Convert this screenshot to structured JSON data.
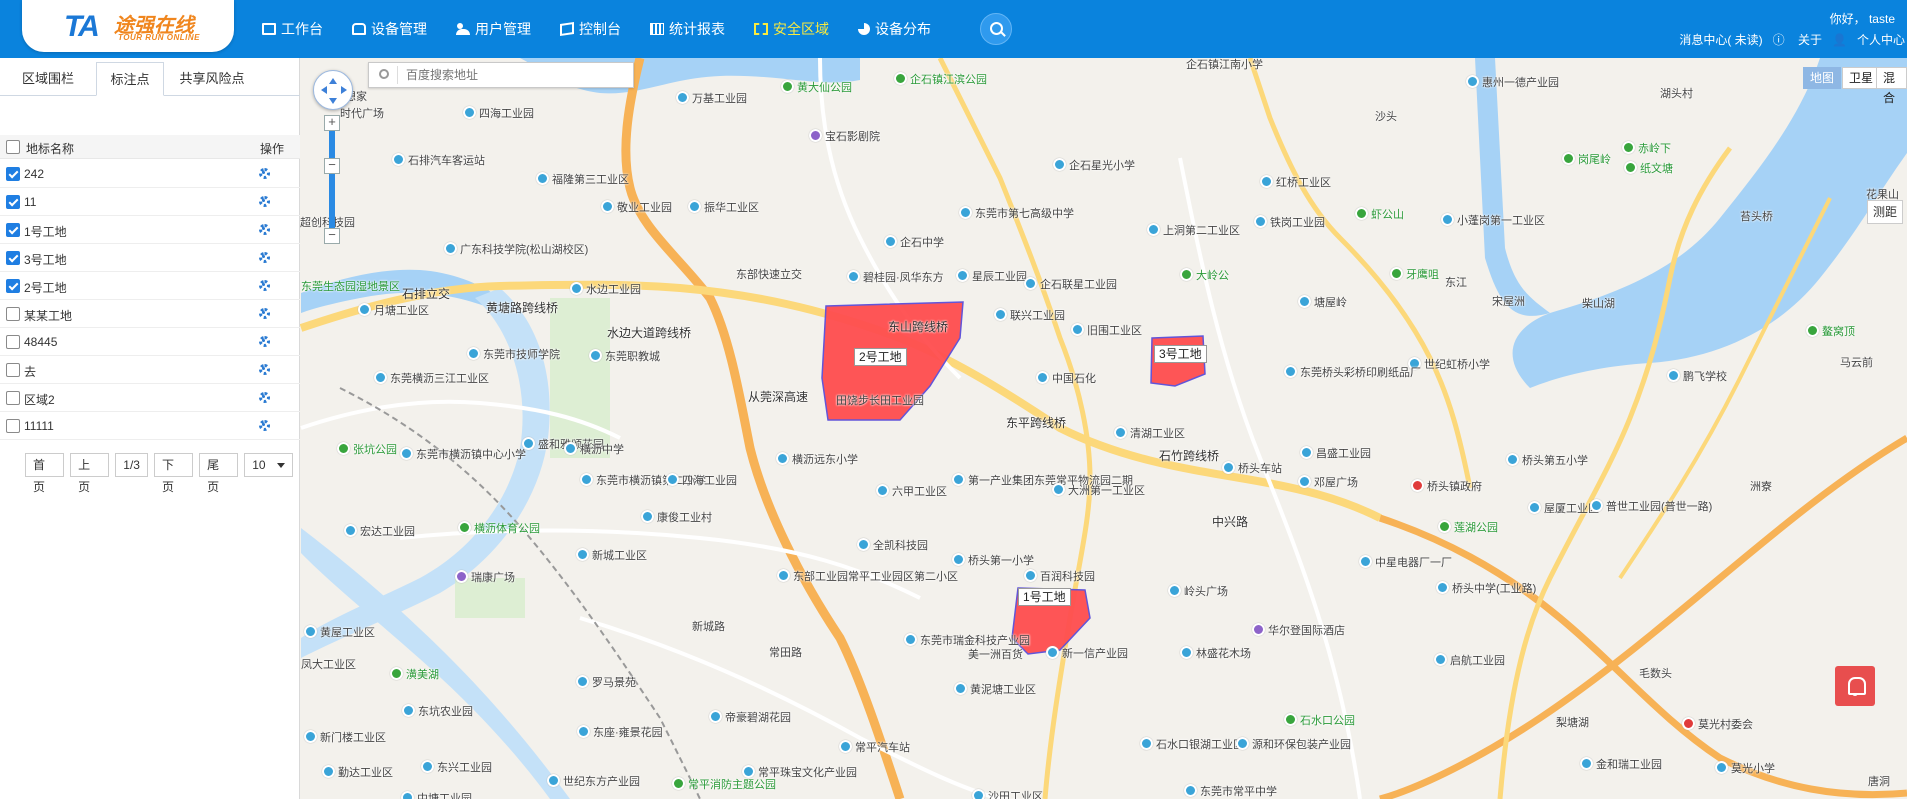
{
  "brand": {
    "logo_mark": "TA",
    "name_cn": "途强在线",
    "name_en": "TOUR RUN ONLINE"
  },
  "nav": [
    {
      "label": "工作台",
      "icon": "desk-icon"
    },
    {
      "label": "设备管理",
      "icon": "car-icon"
    },
    {
      "label": "用户管理",
      "icon": "users-icon"
    },
    {
      "label": "控制台",
      "icon": "map-icon"
    },
    {
      "label": "统计报表",
      "icon": "report-icon"
    },
    {
      "label": "安全区域",
      "icon": "shield-icon",
      "active": true
    },
    {
      "label": "设备分布",
      "icon": "pie-icon"
    }
  ],
  "header_right": {
    "greeting": "你好， taste",
    "messages": "消息中心( 未读)",
    "about": "关于",
    "personal": "个人中心"
  },
  "sidebar": {
    "tabs": [
      "区域围栏",
      "标注点",
      "共享风险点"
    ],
    "active_tab": 1,
    "columns": {
      "name": "地标名称",
      "op": "操作"
    },
    "rows": [
      {
        "name": "242",
        "checked": true
      },
      {
        "name": "11",
        "checked": true
      },
      {
        "name": "1号工地",
        "checked": true
      },
      {
        "name": "3号工地",
        "checked": true
      },
      {
        "name": "2号工地",
        "checked": true
      },
      {
        "name": "某某工地",
        "checked": false
      },
      {
        "name": "48445",
        "checked": false
      },
      {
        "name": "去",
        "checked": false
      },
      {
        "name": "区域2",
        "checked": false
      },
      {
        "name": "11111",
        "checked": false
      }
    ],
    "pager": {
      "first": "首页",
      "prev": "上页",
      "page": "1/3",
      "next": "下页",
      "last": "尾页",
      "size": "10"
    }
  },
  "map": {
    "search_placeholder": "百度搜索地址",
    "map_types": [
      "地图",
      "卫星",
      "混合"
    ],
    "active_type": "地图",
    "ranging": "测距",
    "regions": [
      "2号工地",
      "3号工地",
      "1号工地"
    ],
    "labels": {
      "l1": "万基工业园",
      "l2": "黄大仙公园",
      "l3": "企石镇江滨公园",
      "l4": "企石镇江南小学",
      "l5": "惠州一德产业园",
      "l6": "湖头村",
      "l7": "四海工业园",
      "l8": "宝石影剧院",
      "l9": "沙头",
      "l10": "石排汽车客运站",
      "l11": "福隆第三工业区",
      "l12": "企石星光小学",
      "l13": "红桥工业区",
      "l14": "岗尾岭",
      "l15": "赤岭下",
      "l16": "纸文塘",
      "l17": "敬业工业园",
      "l18": "振华工业区",
      "l19": "东莞市第七高级中学",
      "l20": "上洞第二工业区",
      "l21": "铁岗工业园",
      "l22": "虾公山",
      "l23": "小蓬岗第一工业区",
      "l24": "超创科技园",
      "l25": "企石中学",
      "l26": "广东科技学院(松山湖校区)",
      "l27": "星辰工业园",
      "l28": "企石联星工业园",
      "l29": "大岭公",
      "l30": "牙鹰咀",
      "l31": "东部快速立交",
      "l32": "碧桂园·凤华东方",
      "l33": "东莞生态园湿地景区",
      "l34": "石排立交",
      "l35": "水边工业园",
      "l36": "联兴工业园",
      "l37": "旧围工业区",
      "l38": "塘屋岭",
      "l39": "宋屋洲",
      "l40": "鳌窝顶",
      "l41": "黄塘路跨线桥",
      "l42": "月塘工业区",
      "l43": "水边大道跨线桥",
      "l44": "东山跨线桥",
      "l45": "世纪虹桥小学",
      "l46": "马云前",
      "l47": "东莞市技师学院",
      "l48": "东莞职教城",
      "l49": "中国石化",
      "l50": "东莞桥头彩桥印刷纸品厂",
      "l51": "鹏飞学校",
      "l52": "东莞横沥三江工业区",
      "l53": "田饶步长田工业园",
      "l54": "清湖工业区",
      "l55": "东平跨线桥",
      "l56": "张坑公园",
      "l57": "盛和雅颂花园",
      "l58": "东莞市横沥镇中心小学",
      "l59": "石竹跨线桥",
      "l60": "昌盛工业园",
      "l61": "桥头第五小学",
      "l62": "横沥远东小学",
      "l63": "横沥中学",
      "l64": "东莞市横沥镇第二小学",
      "l65": "四海工业园",
      "l66": "六甲工业区",
      "l67": "第一产业集团东莞常平物流园二期",
      "l68": "大洲第一工业区",
      "l69": "桥头车站",
      "l70": "邓屋广场",
      "l71": "桥头镇政府",
      "l72": "屋厦工业区",
      "l73": "普世工业园(普世一路)",
      "l74": "宏达工业园",
      "l75": "横沥体育公园",
      "l76": "康俊工业村",
      "l77": "全凯科技园",
      "l78": "中兴路",
      "l79": "莲湖公园",
      "l80": "新城工业区",
      "l81": "桥头第一小学",
      "l82": "百润科技园",
      "l83": "中星电器厂一厂",
      "l84": "瑞康广场",
      "l85": "东部工业园常平工业园区第二小区",
      "l86": "岭头广场",
      "l87": "桥头中学(工业路)",
      "l88": "黄屋工业区",
      "l89": "华尔登国际酒店",
      "l90": "启航工业园",
      "l91": "凤大工业区",
      "l92": "东莞市瑞金科技产业园",
      "l93": "美一洲百货",
      "l94": "新一信产业园",
      "l95": "林盛花木场",
      "l96": "毛数头",
      "l97": "潢美湖",
      "l98": "常田路",
      "l99": "罗马景苑",
      "l100": "黄泥塘工业区",
      "l101": "东坑农业园",
      "l102": "帝豪碧湖花园",
      "l103": "石水口公园",
      "l104": "梨塘湖",
      "l105": "莫光村委会",
      "l106": "新门楼工业区",
      "l107": "东座·雍景花园",
      "l108": "常平汽车站",
      "l109": "石水口银湖工业区",
      "l110": "源和环保包装产业园",
      "l111": "金和瑞工业园",
      "l112": "莫光小学",
      "l113": "勤达工业区",
      "l114": "东兴工业园",
      "l115": "世纪东方产业园",
      "l116": "常平珠宝文化产业园",
      "l117": "常平消防主题公园",
      "l118": "沙田工业区",
      "l119": "东莞市常平中学",
      "l120": "中塘工业园",
      "l121": "从莞深高速",
      "l122": "新城路",
      "l123": "想家",
      "l124": "时代广场",
      "l125": "苔头桥",
      "l126": "东江",
      "l127": "柴山湖",
      "l128": "花果山",
      "l129": "洲寮",
      "l130": "唐洞"
    }
  },
  "colors": {
    "header": "#0a83dd",
    "active_nav": "#f8ea3f",
    "region_fill": "#ff4d4f",
    "region_stroke": "#5a4dd9",
    "water": "#a6d2f6",
    "road_major": "#f7b256",
    "road_minor": "#fcd87a"
  }
}
